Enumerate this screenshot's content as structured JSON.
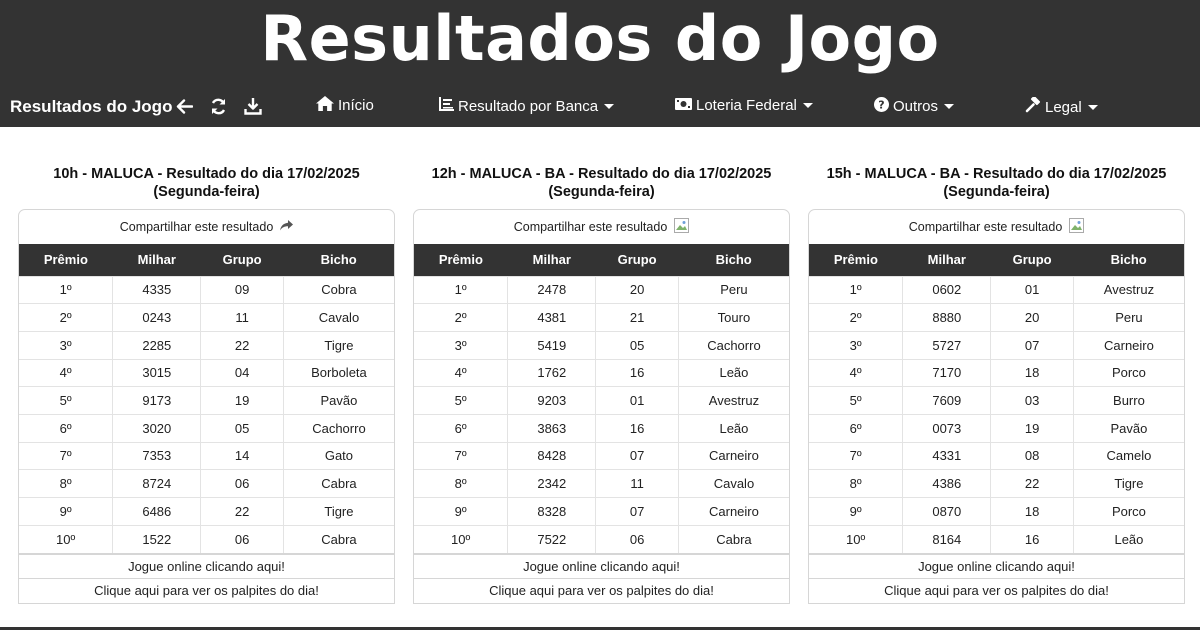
{
  "banner": {
    "title": "Resultados do Jogo"
  },
  "nav": {
    "brand": "Resultados do Jogo",
    "icons": [
      "back-arrow-icon",
      "refresh-icon",
      "download-icon"
    ],
    "links": [
      {
        "label": "Início",
        "icon": "home-icon",
        "dropdown": false
      },
      {
        "label": "Resultado por Banca",
        "icon": "list-icon",
        "dropdown": true
      },
      {
        "label": "Loteria Federal",
        "icon": "money-icon",
        "dropdown": true
      },
      {
        "label": "Outros",
        "icon": "question-circle-icon",
        "dropdown": true
      },
      {
        "label": "Legal",
        "icon": "gavel-icon",
        "dropdown": true
      }
    ]
  },
  "table_headers": [
    "Prêmio",
    "Milhar",
    "Grupo",
    "Bicho"
  ],
  "cards": [
    {
      "title_line1": "10h - MALUCA - Resultado do dia 17/02/2025",
      "title_line2": "(Segunda-feira)",
      "share_label": "Compartilhar este resultado",
      "share_icon": "share-arrow-icon",
      "rows": [
        [
          "1º",
          "4335",
          "09",
          "Cobra"
        ],
        [
          "2º",
          "0243",
          "11",
          "Cavalo"
        ],
        [
          "3º",
          "2285",
          "22",
          "Tigre"
        ],
        [
          "4º",
          "3015",
          "04",
          "Borboleta"
        ],
        [
          "5º",
          "9173",
          "19",
          "Pavão"
        ],
        [
          "6º",
          "3020",
          "05",
          "Cachorro"
        ],
        [
          "7º",
          "7353",
          "14",
          "Gato"
        ],
        [
          "8º",
          "8724",
          "06",
          "Cabra"
        ],
        [
          "9º",
          "6486",
          "22",
          "Tigre"
        ],
        [
          "10º",
          "1522",
          "06",
          "Cabra"
        ]
      ],
      "footer_play": "Jogue online clicando aqui!",
      "footer_tips": "Clique aqui para ver os palpites do dia!"
    },
    {
      "title_line1": "12h - MALUCA - BA - Resultado do dia 17/02/2025",
      "title_line2": "(Segunda-feira)",
      "share_label": "Compartilhar este resultado",
      "share_icon": "broken-image-icon",
      "rows": [
        [
          "1º",
          "2478",
          "20",
          "Peru"
        ],
        [
          "2º",
          "4381",
          "21",
          "Touro"
        ],
        [
          "3º",
          "5419",
          "05",
          "Cachorro"
        ],
        [
          "4º",
          "1762",
          "16",
          "Leão"
        ],
        [
          "5º",
          "9203",
          "01",
          "Avestruz"
        ],
        [
          "6º",
          "3863",
          "16",
          "Leão"
        ],
        [
          "7º",
          "8428",
          "07",
          "Carneiro"
        ],
        [
          "8º",
          "2342",
          "11",
          "Cavalo"
        ],
        [
          "9º",
          "8328",
          "07",
          "Carneiro"
        ],
        [
          "10º",
          "7522",
          "06",
          "Cabra"
        ]
      ],
      "footer_play": "Jogue online clicando aqui!",
      "footer_tips": "Clique aqui para ver os palpites do dia!"
    },
    {
      "title_line1": "15h - MALUCA - BA - Resultado do dia 17/02/2025",
      "title_line2": "(Segunda-feira)",
      "share_label": "Compartilhar este resultado",
      "share_icon": "broken-image-icon",
      "rows": [
        [
          "1º",
          "0602",
          "01",
          "Avestruz"
        ],
        [
          "2º",
          "8880",
          "20",
          "Peru"
        ],
        [
          "3º",
          "5727",
          "07",
          "Carneiro"
        ],
        [
          "4º",
          "7170",
          "18",
          "Porco"
        ],
        [
          "5º",
          "7609",
          "03",
          "Burro"
        ],
        [
          "6º",
          "0073",
          "19",
          "Pavão"
        ],
        [
          "7º",
          "4331",
          "08",
          "Camelo"
        ],
        [
          "8º",
          "4386",
          "22",
          "Tigre"
        ],
        [
          "9º",
          "0870",
          "18",
          "Porco"
        ],
        [
          "10º",
          "8164",
          "16",
          "Leão"
        ]
      ],
      "footer_play": "Jogue online clicando aqui!",
      "footer_tips": "Clique aqui para ver os palpites do dia!"
    }
  ],
  "colors": {
    "header_bg": "#333333",
    "text_light": "#ffffff"
  }
}
